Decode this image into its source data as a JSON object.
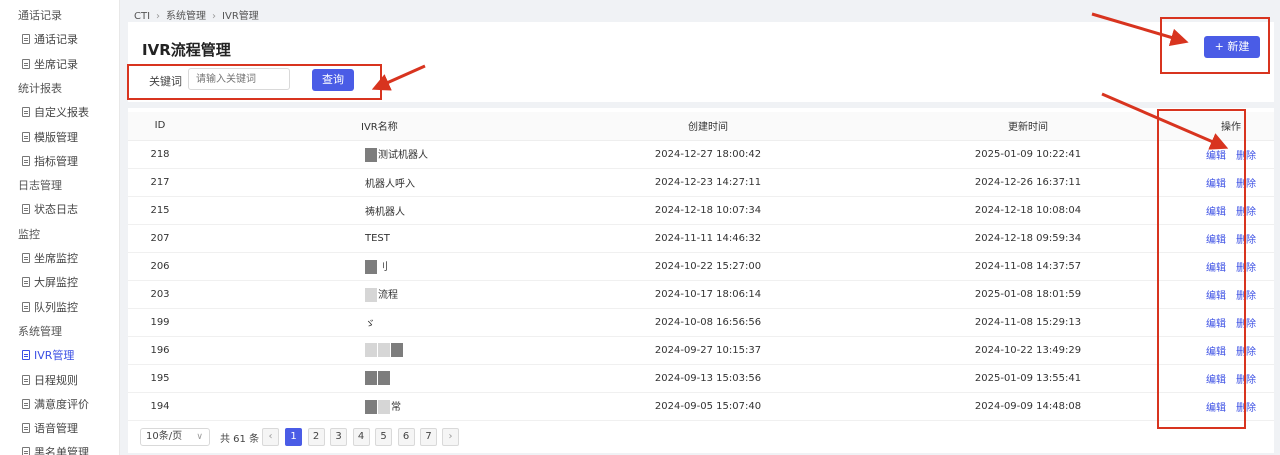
{
  "sidebar": {
    "items": [
      {
        "type": "group",
        "label": "通话记录"
      },
      {
        "type": "child",
        "label": "通话记录"
      },
      {
        "type": "child",
        "label": "坐席记录"
      },
      {
        "type": "group",
        "label": "统计报表"
      },
      {
        "type": "child",
        "label": "自定义报表"
      },
      {
        "type": "child",
        "label": "模版管理"
      },
      {
        "type": "child",
        "label": "指标管理"
      },
      {
        "type": "group",
        "label": "日志管理"
      },
      {
        "type": "child",
        "label": "状态日志"
      },
      {
        "type": "group",
        "label": "监控"
      },
      {
        "type": "child",
        "label": "坐席监控"
      },
      {
        "type": "child",
        "label": "大屏监控"
      },
      {
        "type": "child",
        "label": "队列监控"
      },
      {
        "type": "group",
        "label": "系统管理"
      },
      {
        "type": "child",
        "label": "IVR管理",
        "active": true
      },
      {
        "type": "child",
        "label": "日程规则"
      },
      {
        "type": "child",
        "label": "满意度评价"
      },
      {
        "type": "child",
        "label": "语音管理"
      },
      {
        "type": "child",
        "label": "黑名单管理"
      }
    ]
  },
  "breadcrumb": [
    "CTI",
    "系统管理",
    "IVR管理"
  ],
  "page": {
    "title": "IVR流程管理",
    "keyword_label": "关键词",
    "keyword_placeholder": "请输入关键词",
    "query_button": "查询",
    "new_button": "+ 新建"
  },
  "table": {
    "headers": {
      "id": "ID",
      "name": "IVR名称",
      "created": "创建时间",
      "updated": "更新时间",
      "ops": "操作"
    },
    "edit_label": "编辑",
    "delete_label": "删除",
    "rows": [
      {
        "id": "218",
        "name": "测试机器人",
        "created": "2024-12-27 18:00:42",
        "updated": "2025-01-09 10:22:41"
      },
      {
        "id": "217",
        "name": "机器人呼入",
        "created": "2024-12-23 14:27:11",
        "updated": "2024-12-26 16:37:11"
      },
      {
        "id": "215",
        "name": "祷机器人",
        "created": "2024-12-18 10:07:34",
        "updated": "2024-12-18 10:08:04"
      },
      {
        "id": "207",
        "name": "TEST",
        "created": "2024-11-11 14:46:32",
        "updated": "2024-12-18 09:59:34"
      },
      {
        "id": "206",
        "name": "刂",
        "created": "2024-10-22 15:27:00",
        "updated": "2024-11-08 14:37:57"
      },
      {
        "id": "203",
        "name": "流程",
        "created": "2024-10-17 18:06:14",
        "updated": "2025-01-08 18:01:59"
      },
      {
        "id": "199",
        "name": "ゞ",
        "created": "2024-10-08 16:56:56",
        "updated": "2024-11-08 15:29:13"
      },
      {
        "id": "196",
        "name": "",
        "created": "2024-09-27 10:15:37",
        "updated": "2024-10-22 13:49:29"
      },
      {
        "id": "195",
        "name": "",
        "created": "2024-09-13 15:03:56",
        "updated": "2025-01-09 13:55:41"
      },
      {
        "id": "194",
        "name": "常",
        "created": "2024-09-05 15:07:40",
        "updated": "2024-09-09 14:48:08"
      }
    ]
  },
  "pagination": {
    "page_size": "10条/页",
    "total": "共 61 条",
    "pages": [
      "1",
      "2",
      "3",
      "4",
      "5",
      "6",
      "7"
    ],
    "current": "1",
    "prev": "‹",
    "next": "›"
  },
  "colors": {
    "accent": "#4a5ce6",
    "annotation": "#d8341f"
  }
}
